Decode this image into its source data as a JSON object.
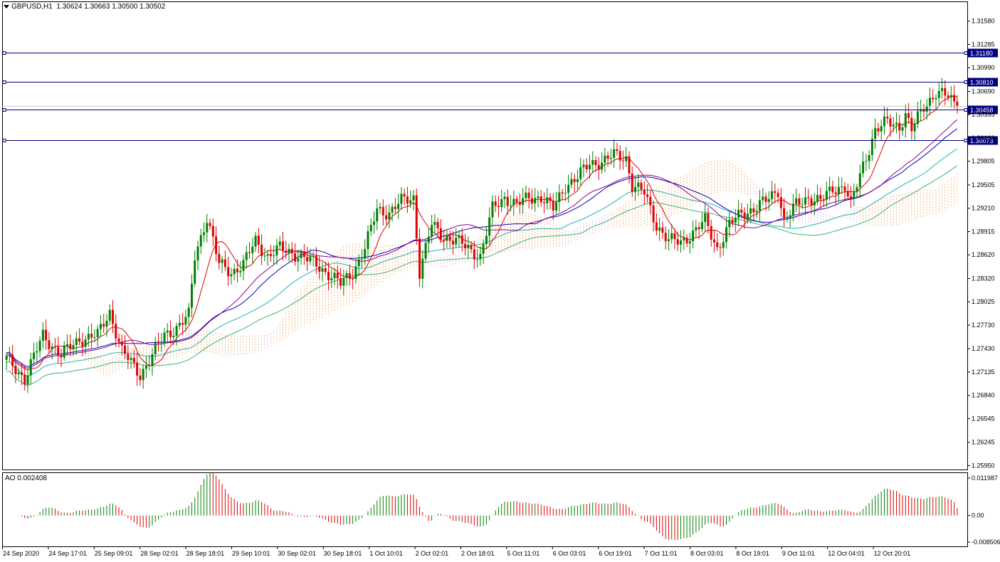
{
  "header": {
    "symbol": "GBPUSD,H1",
    "ohlc": "1.30624 1.30663 1.30500 1.30502"
  },
  "ao_panel": {
    "label": "AO 0.002408"
  },
  "colors": {
    "bull": "#008000",
    "bear": "#e00000",
    "hline": "#000080",
    "cloud": "#f4a460",
    "cloud_alt": "#dda0dd",
    "ma_red": "#e00000",
    "ma_blue": "#0000c0",
    "ma_purple": "#8b008b",
    "ma_teal": "#20b2aa",
    "ma_teal2": "#3cb371"
  },
  "chart_data": {
    "type": "candlestick",
    "symbol": "GBPUSD",
    "timeframe": "H1",
    "price_ticks": [
      "1.31580",
      "1.31285",
      "1.30990",
      "1.30690",
      "1.30395",
      "1.30100",
      "1.29805",
      "1.29505",
      "1.29210",
      "1.28915",
      "1.28620",
      "1.28320",
      "1.28025",
      "1.27730",
      "1.27430",
      "1.27135",
      "1.26840",
      "1.26545",
      "1.26245",
      "1.25950"
    ],
    "price_values": [
      1.3158,
      1.31285,
      1.3099,
      1.3069,
      1.30395,
      1.301,
      1.29805,
      1.29505,
      1.2921,
      1.28915,
      1.2862,
      1.2832,
      1.28025,
      1.2773,
      1.2743,
      1.27135,
      1.2684,
      1.26545,
      1.26245,
      1.2595
    ],
    "ylim": [
      1.259,
      1.3183
    ],
    "time_labels": [
      "24 Sep 2020",
      "24 Sep 17:01",
      "25 Sep 09:01",
      "28 Sep 02:01",
      "28 Sep 18:01",
      "29 Sep 10:01",
      "30 Sep 02:01",
      "30 Sep 18:01",
      "1 Oct 10:01",
      "2 Oct 02:01",
      "2 Oct 18:01",
      "5 Oct 11:01",
      "6 Oct 03:01",
      "6 Oct 19:01",
      "7 Oct 11:01",
      "8 Oct 03:01",
      "8 Oct 19:01",
      "9 Oct 11:01",
      "12 Oct 04:01",
      "12 Oct 20:01"
    ],
    "horizontal_lines": [
      {
        "label": "1.31180",
        "value": 1.3118
      },
      {
        "label": "1.30810",
        "value": 1.3081
      },
      {
        "label": "1.30458",
        "value": 1.30458
      },
      {
        "label": "1.30073",
        "value": 1.30073
      }
    ],
    "current_price": 1.30502,
    "close_path": [
      [
        0,
        1.273
      ],
      [
        6,
        1.2705
      ],
      [
        12,
        1.276
      ],
      [
        18,
        1.2735
      ],
      [
        24,
        1.2755
      ],
      [
        30,
        1.276
      ],
      [
        34,
        1.279
      ],
      [
        38,
        1.274
      ],
      [
        44,
        1.271
      ],
      [
        48,
        1.2735
      ],
      [
        52,
        1.276
      ],
      [
        56,
        1.277
      ],
      [
        60,
        1.2785
      ],
      [
        62,
        1.286
      ],
      [
        66,
        1.291
      ],
      [
        70,
        1.285
      ],
      [
        74,
        1.284
      ],
      [
        78,
        1.285
      ],
      [
        82,
        1.288
      ],
      [
        86,
        1.286
      ],
      [
        90,
        1.287
      ],
      [
        94,
        1.2865
      ],
      [
        98,
        1.2858
      ],
      [
        102,
        1.285
      ],
      [
        106,
        1.2838
      ],
      [
        110,
        1.2825
      ],
      [
        114,
        1.284
      ],
      [
        118,
        1.287
      ],
      [
        122,
        1.292
      ],
      [
        126,
        1.2915
      ],
      [
        130,
        1.293
      ],
      [
        134,
        1.2935
      ],
      [
        136,
        1.284
      ],
      [
        140,
        1.29
      ],
      [
        144,
        1.2885
      ],
      [
        148,
        1.288
      ],
      [
        152,
        1.287
      ],
      [
        156,
        1.286
      ],
      [
        160,
        1.292
      ],
      [
        164,
        1.2935
      ],
      [
        168,
        1.2925
      ],
      [
        172,
        1.2935
      ],
      [
        176,
        1.2935
      ],
      [
        180,
        1.292
      ],
      [
        184,
        1.295
      ],
      [
        188,
        1.296
      ],
      [
        192,
        1.2978
      ],
      [
        196,
        1.298
      ],
      [
        200,
        1.2988
      ],
      [
        204,
        1.2985
      ],
      [
        206,
        1.295
      ],
      [
        210,
        1.294
      ],
      [
        214,
        1.29
      ],
      [
        218,
        1.288
      ],
      [
        222,
        1.2878
      ],
      [
        226,
        1.289
      ],
      [
        230,
        1.2905
      ],
      [
        234,
        1.287
      ],
      [
        238,
        1.29
      ],
      [
        242,
        1.2915
      ],
      [
        246,
        1.292
      ],
      [
        250,
        1.293
      ],
      [
        254,
        1.2945
      ],
      [
        256,
        1.2905
      ],
      [
        260,
        1.2925
      ],
      [
        264,
        1.2935
      ],
      [
        268,
        1.293
      ],
      [
        272,
        1.2945
      ],
      [
        276,
        1.295
      ],
      [
        278,
        1.2925
      ],
      [
        282,
        1.2975
      ],
      [
        286,
        1.302
      ],
      [
        290,
        1.303
      ],
      [
        294,
        1.3025
      ],
      [
        296,
        1.304
      ],
      [
        298,
        1.302
      ],
      [
        302,
        1.305
      ],
      [
        306,
        1.3068
      ],
      [
        310,
        1.3062
      ],
      [
        313,
        1.305
      ]
    ],
    "ao_values": {
      "label": "AO",
      "last": 0.002408,
      "ticks": [
        "0.011987",
        "0.00",
        "-0.008506"
      ],
      "tick_values": [
        0.011987,
        0.0,
        -0.008506
      ]
    }
  }
}
